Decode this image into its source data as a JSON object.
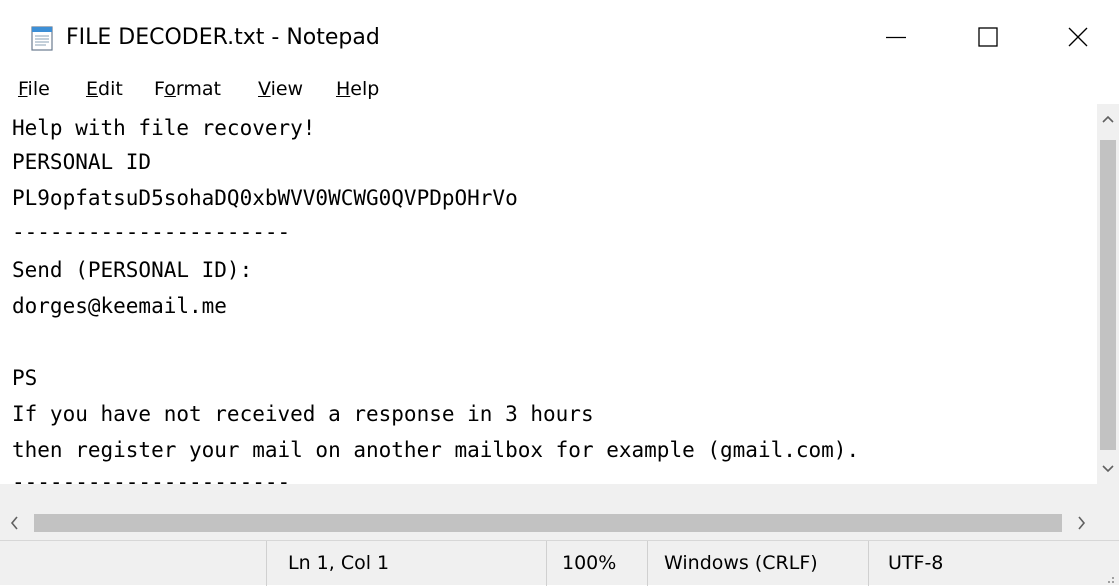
{
  "window": {
    "title": "FILE DECODER.txt - Notepad",
    "app_icon": "notepad-icon"
  },
  "controls": {
    "minimize_icon": "minimize-icon",
    "maximize_icon": "maximize-icon",
    "close_icon": "close-icon"
  },
  "menu": {
    "items": [
      {
        "accel": "F",
        "rest": "ile"
      },
      {
        "accel": "E",
        "rest": "dit"
      },
      {
        "pre": "F",
        "accel": "o",
        "rest": "rmat"
      },
      {
        "accel": "V",
        "rest": "iew"
      },
      {
        "accel": "H",
        "rest": "elp"
      }
    ]
  },
  "editor": {
    "lines": [
      "Help with file recovery!",
      "PERSONAL ID",
      "PL9opfatsuD5sohaDQ0xbWVV0WCWG0QVPDpOHrVo",
      "----------------------",
      "Send (PERSONAL ID):",
      "dorges@keemail.me",
      "",
      "PS",
      "If you have not received a response in 3 hours",
      "then register your mail on another mailbox for example (gmail.com).",
      "----------------------"
    ]
  },
  "statusbar": {
    "position": "Ln 1, Col 1",
    "zoom": "100%",
    "line_ending": "Windows (CRLF)",
    "encoding": "UTF-8"
  },
  "colors": {
    "chrome": "#f0f0f0",
    "scroll_thumb": "#c2c2c2",
    "text": "#000000"
  }
}
